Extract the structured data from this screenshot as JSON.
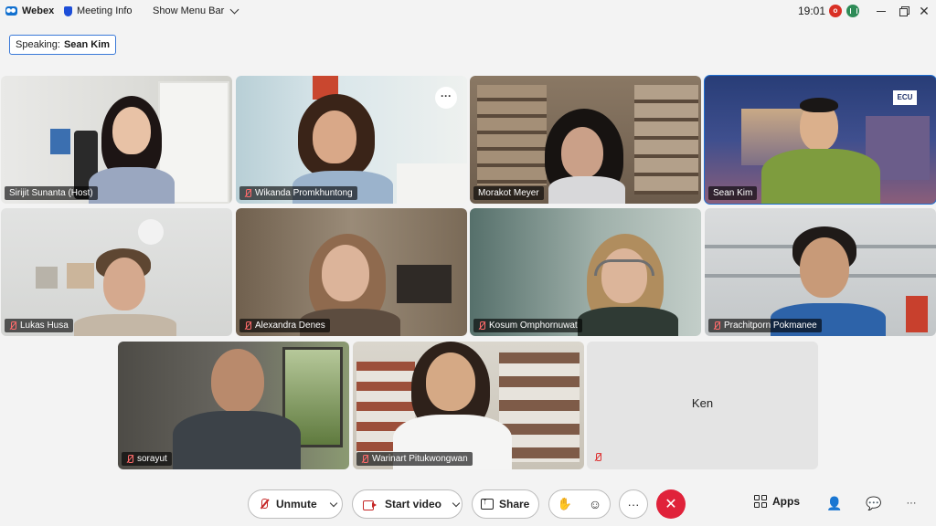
{
  "titlebar": {
    "app_name": "Webex",
    "meeting_info": "Meeting Info",
    "show_menu_bar": "Show Menu Bar",
    "clock": "19:01",
    "recording_letter": "o"
  },
  "speaking": {
    "prefix": "Speaking:",
    "name": "Sean Kim"
  },
  "participants": [
    {
      "name": "Sirijit Sunanta (Host)",
      "muted": false,
      "active_speaker": false
    },
    {
      "name": "Wikanda Promkhuntong",
      "muted": true,
      "active_speaker": false
    },
    {
      "name": "Morakot Meyer",
      "muted": false,
      "active_speaker": false
    },
    {
      "name": "Sean Kim",
      "muted": false,
      "active_speaker": true
    },
    {
      "name": "Lukas Husa",
      "muted": true,
      "active_speaker": false
    },
    {
      "name": "Alexandra Denes",
      "muted": true,
      "active_speaker": false
    },
    {
      "name": "Kosum Omphornuwat",
      "muted": true,
      "active_speaker": false
    },
    {
      "name": "Prachitporn Pokmanee",
      "muted": true,
      "active_speaker": false
    },
    {
      "name": "sorayut",
      "muted": true,
      "active_speaker": false
    },
    {
      "name": "Warinart Pitukwongwan",
      "muted": true,
      "active_speaker": false
    },
    {
      "name": "Ken",
      "muted": true,
      "active_speaker": false,
      "video_off": true
    }
  ],
  "tile_more_label": "···",
  "controls": {
    "unmute": "Unmute",
    "start_video": "Start video",
    "share": "Share",
    "more": "···",
    "end": "✕",
    "apps": "Apps",
    "overflow": "···"
  }
}
